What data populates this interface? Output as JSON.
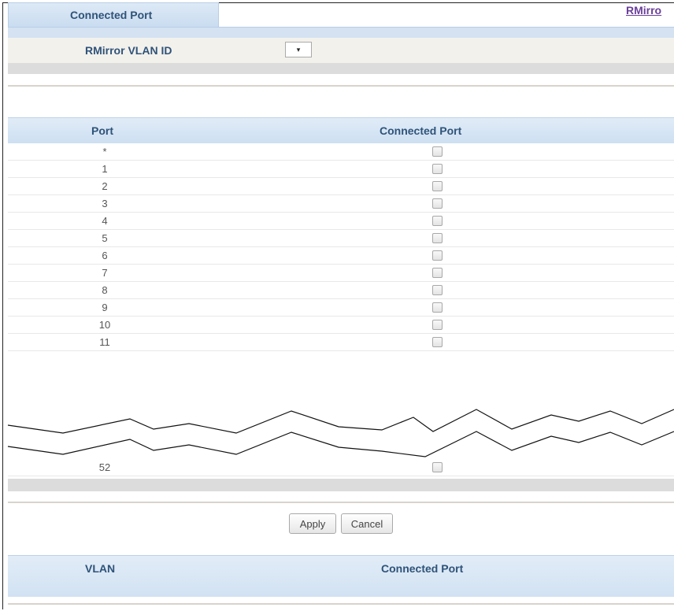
{
  "tabs": {
    "active": "Connected Port",
    "link": "RMirro"
  },
  "vlan": {
    "label": "RMirror VLAN ID",
    "select_value": "▾"
  },
  "ports_table": {
    "headers": [
      "Port",
      "Connected Port"
    ],
    "rows": [
      "*",
      "1",
      "2",
      "3",
      "4",
      "5",
      "6",
      "7",
      "8",
      "9",
      "10",
      "11"
    ],
    "last_row": "52"
  },
  "buttons": {
    "apply": "Apply",
    "cancel": "Cancel"
  },
  "vlan_table": {
    "headers": [
      "VLAN",
      "Connected Port"
    ]
  }
}
